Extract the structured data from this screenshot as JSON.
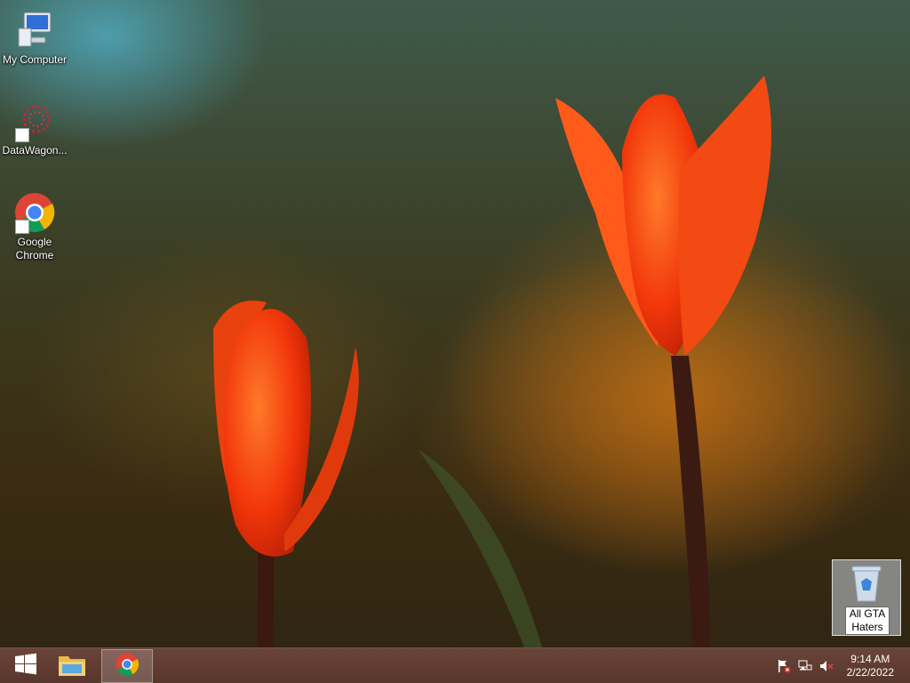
{
  "desktop_icons": [
    {
      "label": "My Computer",
      "icon": "computer-icon"
    },
    {
      "label": "DataWagon...",
      "icon": "datawagon-icon"
    },
    {
      "label": "Google Chrome",
      "icon": "chrome-icon"
    }
  ],
  "recycle_bin": {
    "icon": "recycle-bin-icon",
    "rename_value": "All GTA Haters"
  },
  "taskbar": {
    "start_icon": "windows-logo-icon",
    "pinned": [
      {
        "name": "file-explorer-icon"
      },
      {
        "name": "chrome-icon",
        "active": true
      }
    ],
    "tray": [
      "action-center-flag-icon",
      "network-icon",
      "volume-muted-icon"
    ],
    "clock": {
      "time": "9:14 AM",
      "date": "2/22/2022"
    }
  },
  "colors": {
    "taskbar": "#6e463c",
    "tulip": "#ff4a12"
  }
}
